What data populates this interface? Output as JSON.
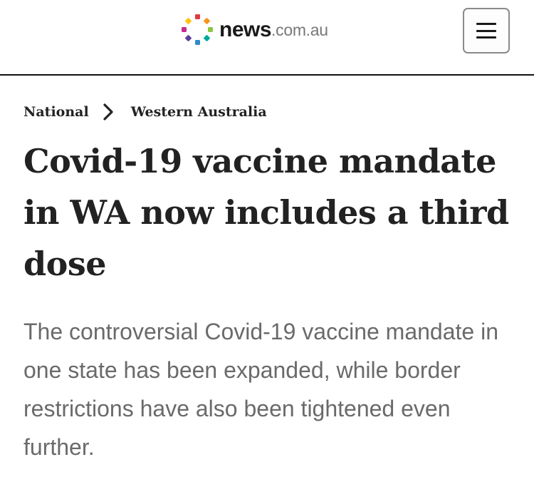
{
  "header": {
    "logo": {
      "word": "news",
      "suffix": ".com.au",
      "icon": "news-pinwheel-logo-icon",
      "dot_colors": [
        "#e03a3e",
        "#f7941d",
        "#8dc63f",
        "#00a99d",
        "#2e8bc9",
        "#5b3f99",
        "#c62b8f",
        "#ffc20e"
      ]
    },
    "menu_icon": "hamburger-menu-icon"
  },
  "breadcrumb": {
    "items": [
      "National",
      "Western Australia"
    ],
    "separator_icon": "chevron-right-icon"
  },
  "article": {
    "headline": "Covid-19 vaccine mandate in WA now includes a third dose",
    "standfirst": "The controversial Covid-19 vaccine mandate in one state has been expanded, while border restrictions have also been tightened even further."
  }
}
